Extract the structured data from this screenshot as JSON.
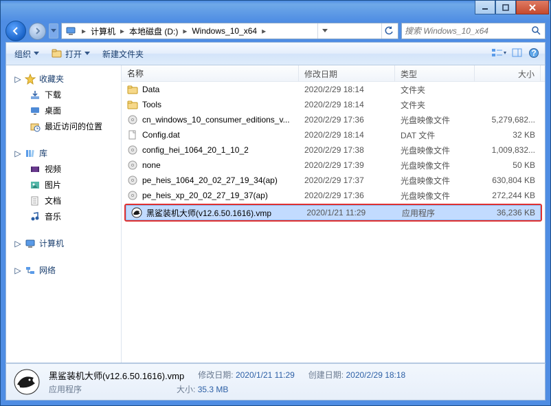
{
  "breadcrumb": {
    "segments": [
      "计算机",
      "本地磁盘 (D:)",
      "Windows_10_x64"
    ]
  },
  "search": {
    "placeholder": "搜索 Windows_10_x64"
  },
  "toolbar": {
    "organize": "组织",
    "open": "打开",
    "new_folder": "新建文件夹"
  },
  "sidebar": {
    "favorites": {
      "label": "收藏夹",
      "items": [
        "下载",
        "桌面",
        "最近访问的位置"
      ]
    },
    "libraries": {
      "label": "库",
      "items": [
        "视频",
        "图片",
        "文档",
        "音乐"
      ]
    },
    "computer": {
      "label": "计算机"
    },
    "network": {
      "label": "网络"
    }
  },
  "columns": {
    "name": "名称",
    "date": "修改日期",
    "type": "类型",
    "size": "大小"
  },
  "files": [
    {
      "name": "Data",
      "date": "2020/2/29 18:14",
      "type": "文件夹",
      "size": "",
      "icon": "folder"
    },
    {
      "name": "Tools",
      "date": "2020/2/29 18:14",
      "type": "文件夹",
      "size": "",
      "icon": "folder"
    },
    {
      "name": "cn_windows_10_consumer_editions_v...",
      "date": "2020/2/29 17:36",
      "type": "光盘映像文件",
      "size": "5,279,682...",
      "icon": "iso"
    },
    {
      "name": "Config.dat",
      "date": "2020/2/29 18:14",
      "type": "DAT 文件",
      "size": "32 KB",
      "icon": "file"
    },
    {
      "name": "config_hei_1064_20_1_10_2",
      "date": "2020/2/29 17:38",
      "type": "光盘映像文件",
      "size": "1,009,832...",
      "icon": "iso"
    },
    {
      "name": "none",
      "date": "2020/2/29 17:39",
      "type": "光盘映像文件",
      "size": "50 KB",
      "icon": "iso"
    },
    {
      "name": "pe_heis_1064_20_02_27_19_34(ap)",
      "date": "2020/2/29 17:37",
      "type": "光盘映像文件",
      "size": "630,804 KB",
      "icon": "iso"
    },
    {
      "name": "pe_heis_xp_20_02_27_19_37(ap)",
      "date": "2020/2/29 17:36",
      "type": "光盘映像文件",
      "size": "272,244 KB",
      "icon": "iso"
    },
    {
      "name": "黑鲨装机大师(v12.6.50.1616).vmp",
      "date": "2020/1/21 11:29",
      "type": "应用程序",
      "size": "36,236 KB",
      "icon": "shark",
      "highlight": true
    }
  ],
  "details": {
    "name": "黑鲨装机大师(v12.6.50.1616).vmp",
    "type": "应用程序",
    "mod_label": "修改日期:",
    "mod_value": "2020/1/21 11:29",
    "create_label": "创建日期:",
    "create_value": "2020/2/29 18:18",
    "size_label": "大小:",
    "size_value": "35.3 MB"
  }
}
